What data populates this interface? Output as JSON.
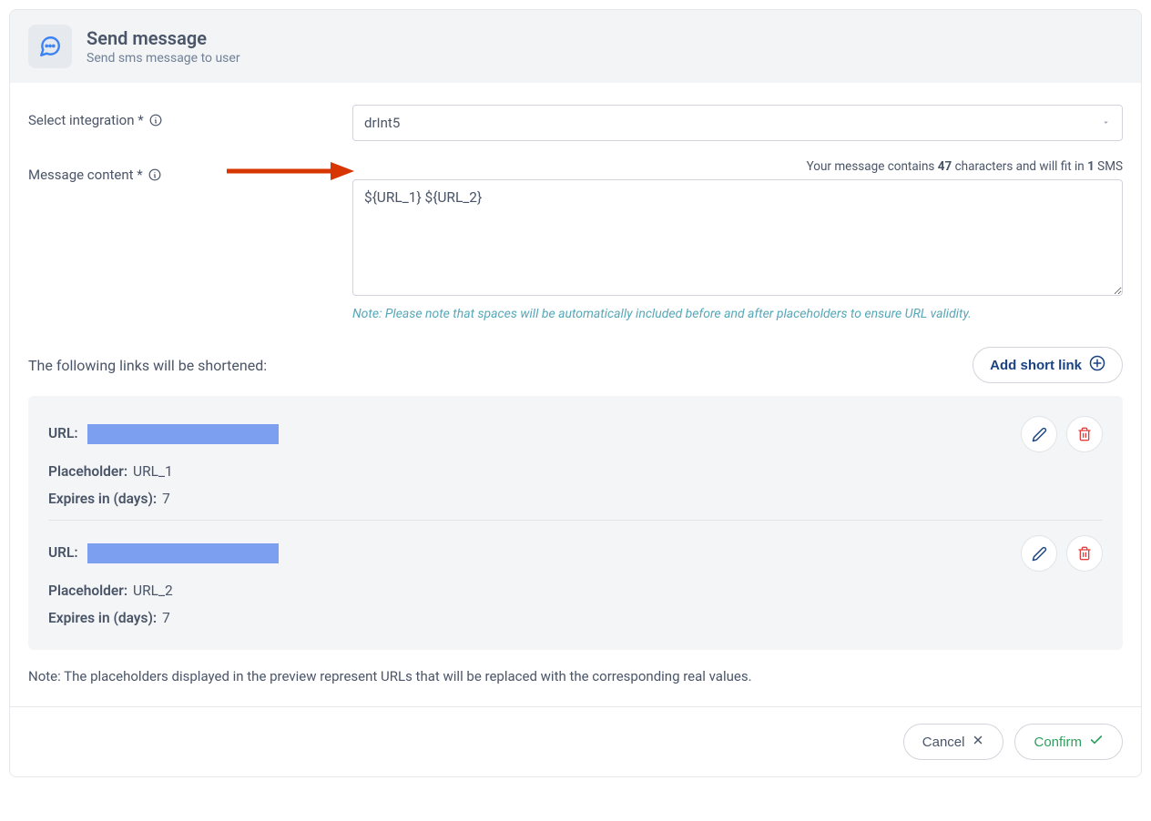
{
  "header": {
    "title": "Send message",
    "subtitle": "Send sms message to user"
  },
  "form": {
    "integration": {
      "label": "Select integration *",
      "value": "drInt5"
    },
    "message": {
      "label": "Message content *",
      "value": "${URL_1} ${URL_2}",
      "char_count_prefix": "Your message contains ",
      "char_count": "47",
      "char_count_mid": " characters and will fit in ",
      "sms_count": "1",
      "char_count_suffix": " SMS",
      "note": "Note: Please note that spaces will be automatically included before and after placeholders to ensure URL validity."
    }
  },
  "links": {
    "title": "The following links will be shortened:",
    "add_button": "Add short link",
    "url_label": "URL:",
    "placeholder_label": "Placeholder:",
    "expires_label": "Expires in (days):",
    "items": [
      {
        "placeholder": "URL_1",
        "expires": "7"
      },
      {
        "placeholder": "URL_2",
        "expires": "7"
      }
    ]
  },
  "bottom_note": "Note: The placeholders displayed in the preview represent URLs that will be replaced with the corresponding real values.",
  "footer": {
    "cancel": "Cancel",
    "confirm": "Confirm"
  }
}
